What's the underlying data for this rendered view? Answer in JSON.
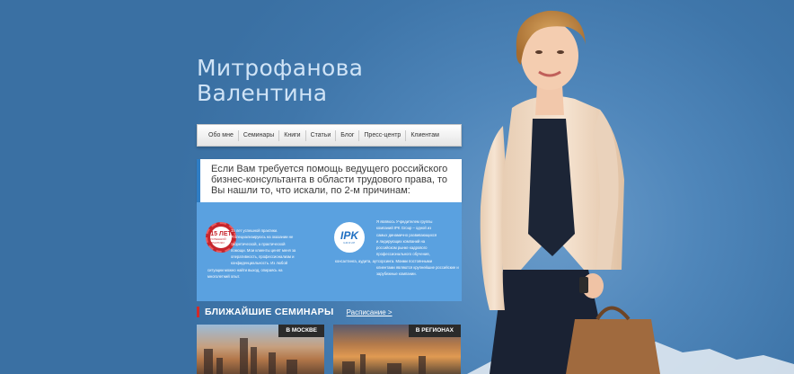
{
  "person": {
    "name_line1": "Митрофанова",
    "name_line2": "Валентина"
  },
  "nav": {
    "items": [
      {
        "label": "Обо мне"
      },
      {
        "label": "Семинары"
      },
      {
        "label": "Книги"
      },
      {
        "label": "Статьи"
      },
      {
        "label": "Блог"
      },
      {
        "label": "Пресс-центр"
      },
      {
        "label": "Клиентам"
      }
    ]
  },
  "intro": {
    "line1": "Если Вам требуется помощь ведущего российского",
    "line2": "бизнес-консультанта в области трудового права, то",
    "line3": "Вы нашли то, что искали, по 2-м причинам:"
  },
  "reason1": {
    "badge_big": "15 ЛЕТ",
    "badge_small": "УСПЕШНОЙ ПРАКТИКИ",
    "lines": [
      "15 лет успешной практики.",
      "Я специализируюсь на оказании не",
      "теоретической, а практической",
      "помощи. Мои клиенты ценят меня за",
      "оперативность, профессионализм и",
      "конфиденциальность. Из любой",
      "ситуации можно найти выход, опираясь на",
      "многолетний опыт."
    ]
  },
  "reason2": {
    "logo": "IPK",
    "logo_sub": "GROUP",
    "lines": [
      "Я являюсь Учредителем группы",
      "компаний IPK Group – одной из",
      "самых динамично развивающихся",
      "и лидирующих компаний на",
      "российском рынке кадрового",
      "профессионального обучения,",
      "консалтинга, аудита, аутсорсинга. Моими постоянными",
      "клиентами являются крупнейшие российские и",
      "зарубежные компании."
    ]
  },
  "seminars": {
    "title": "БЛИЖАЙШИЕ СЕМИНАРЫ",
    "schedule_link": "Расписание >",
    "cards": [
      {
        "label": "В МОСКВЕ"
      },
      {
        "label": "В РЕГИОНАХ"
      }
    ]
  },
  "colors": {
    "background": "#4f86ba",
    "accent_red": "#d12a2a",
    "panel_blue": "#5aa1e0"
  }
}
